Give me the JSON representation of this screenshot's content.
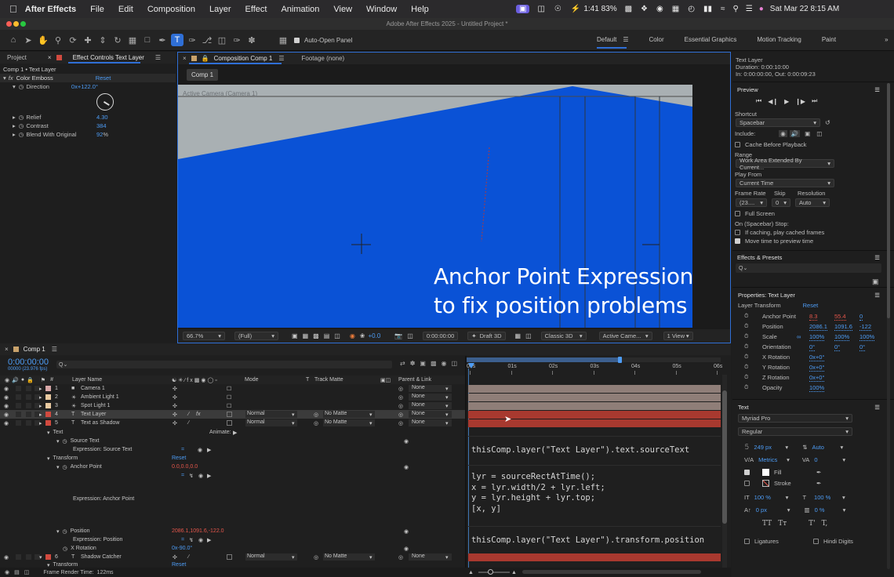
{
  "menubar": {
    "app": "After Effects",
    "items": [
      "File",
      "Edit",
      "Composition",
      "Layer",
      "Effect",
      "Animation",
      "View",
      "Window",
      "Help"
    ],
    "battery": "1:41 83%",
    "datetime": "Sat Mar 22  8:15 AM"
  },
  "window": {
    "title": "Adobe After Effects 2025 - Untitled Project *"
  },
  "toolbar": {
    "auto_open_label": "Auto-Open Panel",
    "workspaces": [
      "Default",
      "Color",
      "Essential Graphics",
      "Motion Tracking",
      "Paint"
    ]
  },
  "left_panel": {
    "tabs": [
      "Project",
      "Effect Controls Text Layer"
    ],
    "header": "Comp 1 • Text Layer",
    "effect_name": "Color Emboss",
    "reset": "Reset",
    "direction_label": "Direction",
    "direction_value": "0x+122.0°",
    "relief_label": "Relief",
    "relief_value": "4.30",
    "contrast_label": "Contrast",
    "contrast_value": "384",
    "blend_label": "Blend With Original",
    "blend_value": "92",
    "blend_unit": "%"
  },
  "comp_panel": {
    "tab": "Composition Comp 1",
    "footage_tab": "Footage (none)",
    "comp_chip": "Comp 1",
    "camera_label": "Active Camera (Camera 1)",
    "overlay_line1": "Anchor Point Expression",
    "overlay_line2": "to fix position problems",
    "footer": {
      "zoom": "66.7%",
      "resolution": "(Full)",
      "timecode": "0:00:00:00",
      "draft": "Draft 3D",
      "renderer": "Classic 3D",
      "camera": "Active Came...",
      "view": "1 View",
      "exposure": "+0.0"
    }
  },
  "right_panel": {
    "layer_name": "Text Layer",
    "duration": "Duration: 0:00:10:00",
    "inout": "In: 0:00:00:00, Out: 0:00:09:23",
    "preview": {
      "title": "Preview",
      "shortcut_label": "Shortcut",
      "shortcut_value": "Spacebar",
      "include_label": "Include:",
      "cache_label": "Cache Before Playback",
      "range_label": "Range",
      "range_value": "Work Area Extended By Current...",
      "playfrom_label": "Play From",
      "playfrom_value": "Current Time",
      "framerate_label": "Frame Rate",
      "skip_label": "Skip",
      "res_label": "Resolution",
      "framerate_value": "(23....",
      "skip_value": "0",
      "res_value": "Auto",
      "fullscreen_label": "Full Screen",
      "stop_label": "On (Spacebar) Stop:",
      "caching_label": "If caching, play cached frames",
      "move_label": "Move time to preview time"
    },
    "effects_presets": {
      "title": "Effects & Presets",
      "search_placeholder": "Q⌄"
    },
    "properties": {
      "title": "Properties: Text Layer",
      "transform_label": "Layer Transform",
      "reset": "Reset",
      "rows": [
        {
          "label": "Anchor Point",
          "v": [
            "8.3",
            "55.4",
            "0"
          ],
          "red": true
        },
        {
          "label": "Position",
          "v": [
            "2086.1",
            "1091.6",
            "-122"
          ],
          "red": false
        },
        {
          "label": "Scale",
          "v": [
            "100%",
            "100%",
            "100%"
          ],
          "red": false
        },
        {
          "label": "Orientation",
          "v": [
            "0°",
            "0°",
            "0°"
          ],
          "red": false
        },
        {
          "label": "X Rotation",
          "v": [
            "0x+0°",
            "",
            ""
          ],
          "red": false
        },
        {
          "label": "Y Rotation",
          "v": [
            "0x+0°",
            "",
            ""
          ],
          "red": false
        },
        {
          "label": "Z Rotation",
          "v": [
            "0x+0°",
            "",
            ""
          ],
          "red": false
        },
        {
          "label": "Opacity",
          "v": [
            "100%",
            "",
            ""
          ],
          "red": false
        }
      ]
    },
    "text": {
      "title": "Text",
      "font": "Myriad Pro",
      "style": "Regular",
      "size": "249 px",
      "leading": "Auto",
      "kerning": "Metrics",
      "tracking": "0",
      "fill_label": "Fill",
      "stroke_label": "Stroke",
      "vscale": "100 %",
      "hscale": "100 %",
      "baseline": "0 px",
      "tsume": "0 %",
      "tt1": "TT",
      "tt2": "Tт",
      "t1": "T'",
      "t2": "T,",
      "ligatures": "Ligatures",
      "hindi": "Hindi Digits"
    }
  },
  "timeline": {
    "tab": "Comp 1",
    "timecode": "0:00:00:00",
    "fps": "00000 (23.976 fps)",
    "search_placeholder": "Q⌄",
    "col_layer": "Layer Name",
    "col_mode": "Mode",
    "col_t": "T",
    "col_matte": "Track Matte",
    "col_parent": "Parent & Link",
    "col_num": "#",
    "ruler": [
      "00s",
      "01s",
      "02s",
      "03s",
      "04s",
      "05s",
      "06s"
    ],
    "layers": [
      {
        "num": "1",
        "name": "Camera 1",
        "color": "#d7a7a7",
        "parent": "None"
      },
      {
        "num": "2",
        "name": "Ambient Light 1",
        "color": "#e8c9a0",
        "parent": "None"
      },
      {
        "num": "3",
        "name": "Spot Light 1",
        "color": "#e8c9a0",
        "parent": "None"
      },
      {
        "num": "4",
        "name": "Text Layer",
        "color": "#d14a3f",
        "parent": "None",
        "mode": "Normal",
        "matte": "No Matte"
      },
      {
        "num": "5",
        "name": "Text as Shadow",
        "color": "#d14a3f",
        "parent": "None",
        "mode": "Normal",
        "matte": "No Matte"
      },
      {
        "num": "6",
        "name": "Shadow Catcher",
        "color": "#d14a3f",
        "parent": "None",
        "mode": "Normal",
        "matte": "No Matte"
      }
    ],
    "props": {
      "text": "Text",
      "animate": "Animate:",
      "source_text": "Source Text",
      "expr_source": "Expression: Source Text",
      "transform": "Transform",
      "reset": "Reset",
      "anchor": "Anchor Point",
      "anchor_val": "0.0,0.0,0.0",
      "expr_anchor": "Expression: Anchor Point",
      "position": "Position",
      "position_val": "2086.1,1091.6,-122.0",
      "expr_position": "Expression: Position",
      "xrot": "X Rotation",
      "xrot_val": "0x-90.0°",
      "transform2": "Transform"
    },
    "expr": {
      "source": "thisComp.layer(\"Text Layer\").text.sourceText",
      "a1": "lyr = sourceRectAtTime();",
      "a2": "x = lyr.width/2 + lyr.left;",
      "a3": "y = lyr.height + lyr.top;",
      "a4": "[x, y]",
      "pos": "thisComp.layer(\"Text Layer\").transform.position"
    },
    "render_label": "Frame Render Time:",
    "render_value": "122ms"
  },
  "colors": {
    "accent": "#2f6fd6",
    "comp_blue": "#0a52d6",
    "sky": "#a9b0b3",
    "bar_red": "#a8392f",
    "bar_tan": "#8f7e78"
  }
}
